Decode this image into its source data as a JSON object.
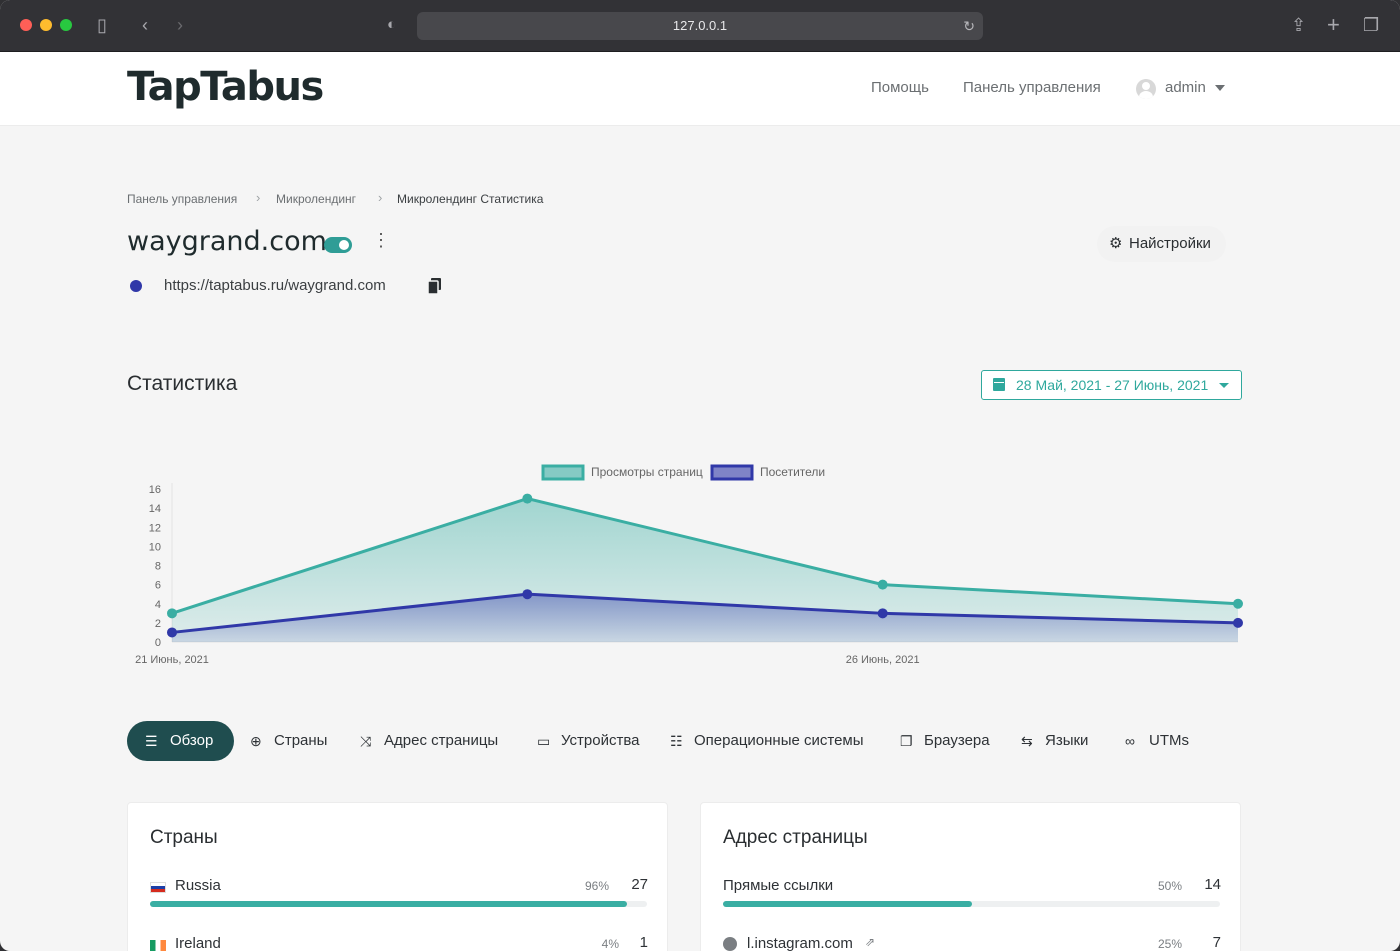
{
  "browser": {
    "url": "127.0.0.1"
  },
  "header": {
    "logo": "TapTabus",
    "nav": {
      "help": "Помощь",
      "dashboard": "Панель управления"
    },
    "user": "admin"
  },
  "breadcrumb": [
    "Панель управления",
    "Микролендинг",
    "Микролендинг Статистика"
  ],
  "page": {
    "title": "waygrand.com",
    "enabled": true,
    "url": "https://taptabus.ru/waygrand.com",
    "settings_label": "Найстройки"
  },
  "stats": {
    "heading": "Статистика",
    "date_range": "28 Май, 2021 - 27 Июнь, 2021"
  },
  "chart_data": {
    "type": "area",
    "legend": [
      "Просмотры страниц",
      "Посетители"
    ],
    "legend_position": "top",
    "x_labels": [
      "21 Июнь, 2021",
      "26 Июнь, 2021"
    ],
    "y_ticks": [
      "0",
      "2",
      "4",
      "6",
      "8",
      "10",
      "12",
      "14",
      "16"
    ],
    "ylim": [
      0,
      16
    ],
    "series": [
      {
        "name": "Просмотры страниц",
        "color": "#3aaea3",
        "values": [
          3,
          15,
          6,
          4
        ]
      },
      {
        "name": "Посетители",
        "color": "#3038a8",
        "values": [
          1,
          5,
          3,
          2
        ]
      }
    ]
  },
  "tabs": [
    {
      "label": "Обзор",
      "icon": "list-icon",
      "glyph": "☰"
    },
    {
      "label": "Страны",
      "icon": "globe-icon",
      "glyph": "⊕"
    },
    {
      "label": "Адрес страницы",
      "icon": "shuffle-icon",
      "glyph": "⤨"
    },
    {
      "label": "Устройства",
      "icon": "laptop-icon",
      "glyph": "▭"
    },
    {
      "label": "Операционные системы",
      "icon": "server-icon",
      "glyph": "☷"
    },
    {
      "label": "Браузера",
      "icon": "window-icon",
      "glyph": "❐"
    },
    {
      "label": "Языки",
      "icon": "language-icon",
      "glyph": "⇆"
    },
    {
      "label": "UTMs",
      "icon": "link-icon",
      "glyph": "∞"
    }
  ],
  "countries_card": {
    "title": "Страны",
    "rows": [
      {
        "label": "Russia",
        "percent": "96%",
        "count": "27",
        "fraction": 0.96
      },
      {
        "label": "Ireland",
        "percent": "4%",
        "count": "1",
        "fraction": 0.04
      }
    ]
  },
  "referrers_card": {
    "title": "Адрес страницы",
    "rows": [
      {
        "label": "Прямые ссылки",
        "percent": "50%",
        "count": "14",
        "fraction": 0.5
      },
      {
        "label": "l.instagram.com",
        "percent": "25%",
        "count": "7",
        "fraction": 0.25
      }
    ]
  }
}
